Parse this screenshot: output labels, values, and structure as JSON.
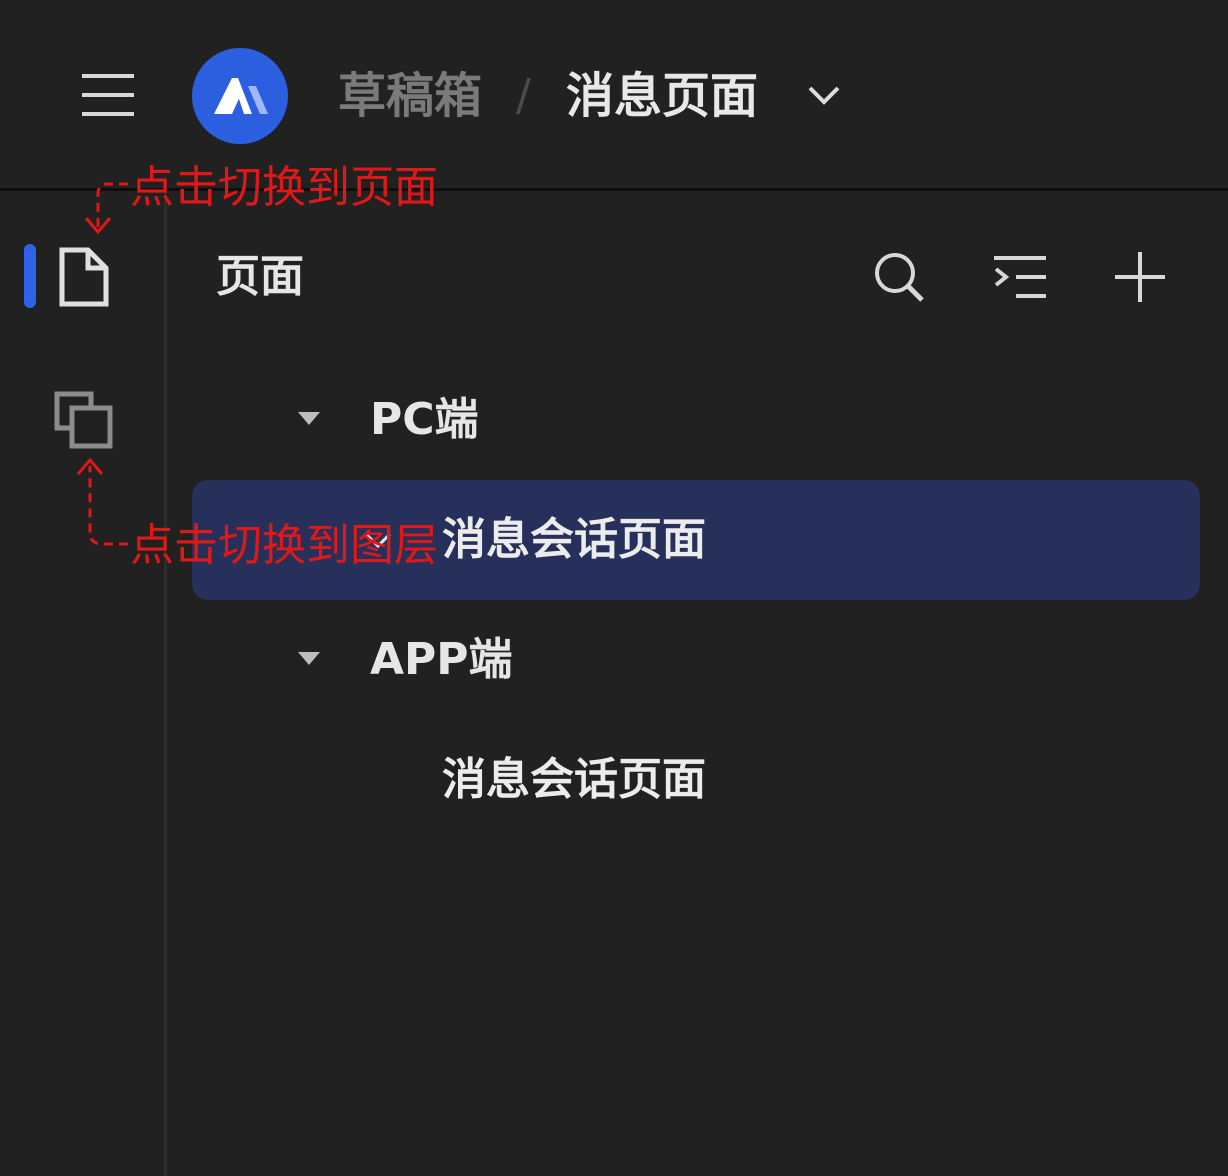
{
  "header": {
    "breadcrumb_parent": "草稿箱",
    "breadcrumb_separator": "/",
    "breadcrumb_current": "消息页面"
  },
  "panel": {
    "title": "页面",
    "tree": [
      {
        "label": "PC端",
        "children": [
          {
            "label": "消息会话页面",
            "selected": true
          }
        ]
      },
      {
        "label": "APP端",
        "children": [
          {
            "label": "消息会话页面",
            "selected": false
          }
        ]
      }
    ]
  },
  "annotations": {
    "to_pages": "点击切换到页面",
    "to_layers": "点击切换到图层"
  },
  "colors": {
    "background": "#212121",
    "accent": "#2e62e8",
    "selected_row": "#26305a",
    "annotation": "#e01818"
  },
  "icons": [
    "menu-icon",
    "logo-icon",
    "chevron-down-icon",
    "page-icon",
    "layers-icon",
    "search-icon",
    "outline-icon",
    "plus-icon",
    "caret-down-icon"
  ]
}
